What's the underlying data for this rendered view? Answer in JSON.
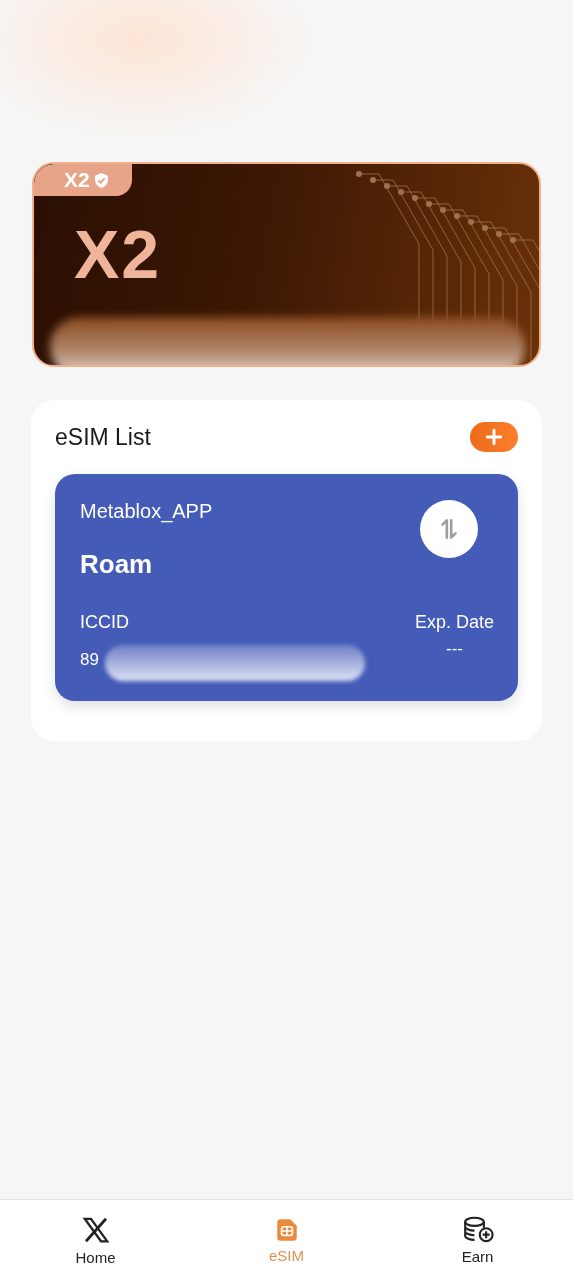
{
  "banner": {
    "badge": "X2",
    "title": "X2"
  },
  "esim_list": {
    "title": "eSIM List",
    "cards": [
      {
        "provider": "Metablox_APP",
        "plan": "Roam",
        "iccid_label": "ICCID",
        "iccid_value": "89",
        "exp_label": "Exp. Date",
        "exp_value": "---"
      }
    ]
  },
  "nav": [
    {
      "label": "Home",
      "kind": "home",
      "selected": false
    },
    {
      "label": "eSIM",
      "kind": "esim",
      "selected": true
    },
    {
      "label": "Earn",
      "kind": "earn",
      "selected": false
    }
  ]
}
